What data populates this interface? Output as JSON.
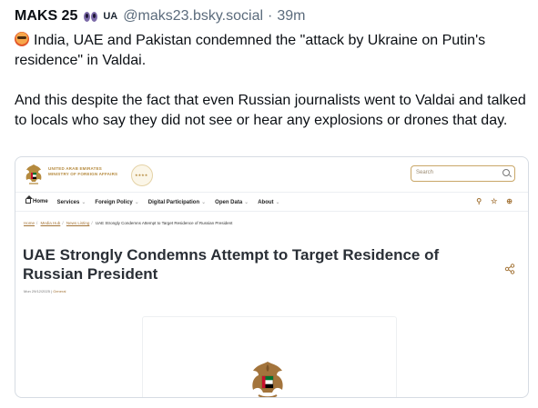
{
  "post": {
    "author_name": "MAKS 25",
    "flag_text": "UA",
    "handle": "@maks23.bsky.social",
    "separator": "·",
    "time": "39m",
    "paragraph_1": "India, UAE and Pakistan condemned the \"attack by Ukraine on Putin's residence\" in Valdai.",
    "paragraph_2": "And this despite the fact that even Russian journalists went to Valdai and talked to locals who say they did not see or hear any explosions or drones that day."
  },
  "embed": {
    "ministry_line_1": "UNITED ARAB EMIRATES",
    "ministry_line_2": "MINISTRY OF FOREIGN AFFAIRS",
    "search_placeholder": "Search",
    "nav": [
      "Home",
      "Services",
      "Foreign Policy",
      "Digital Participation",
      "Open Data",
      "About"
    ],
    "breadcrumb": [
      "Home",
      "Media Hub",
      "News Listing",
      "UAE Strongly Condemns Attempt to Target Residence of Russian President"
    ],
    "title": "UAE Strongly Condemns Attempt to Target Residence of Russian President",
    "date": "Mon 29/12/2025",
    "meta_separator": "|",
    "category": "General"
  },
  "colors": {
    "text": "#0b0f14",
    "muted": "#5b6b7c",
    "gold": "#a5763a",
    "card_border": "#d6dce3"
  },
  "icons": [
    "eyes-icon",
    "hot-face-icon",
    "uae-emblem-icon",
    "search-icon",
    "home-icon",
    "user-icon",
    "star-icon",
    "globe-icon",
    "share-icon"
  ]
}
